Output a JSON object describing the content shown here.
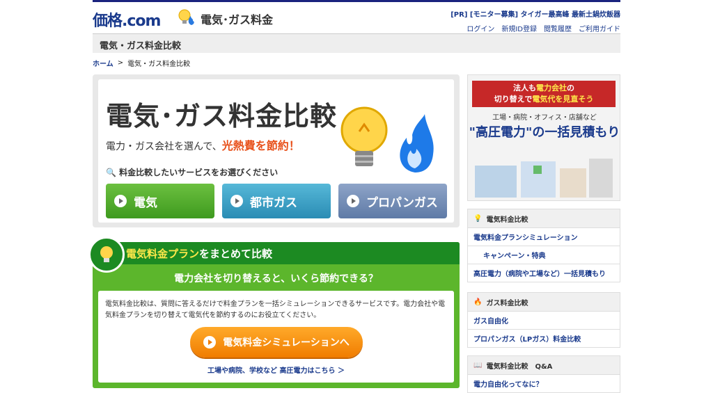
{
  "header": {
    "logo_text": "価格.com",
    "service_name": "電気･ガス料金",
    "pr_text": "[PR] [モニター募集] タイガー最高峰 最新土鍋炊飯器",
    "util_links": [
      "ログイン",
      "新規ID登録",
      "閲覧履歴",
      "ご利用ガイド"
    ]
  },
  "titlebar": {
    "title": "電気・ガス料金比較"
  },
  "breadcrumb": {
    "home": "ホーム",
    "sep": ">",
    "current": "電気・ガス料金比較"
  },
  "hero": {
    "title": "電気･ガス料金比較",
    "sub_pre": "電力・ガス会社を選んで、",
    "sub_em": "光熱費を節約！",
    "question": "料金比較したいサービスをお選びください",
    "services": [
      "電気",
      "都市ガス",
      "プロパンガス"
    ]
  },
  "plan": {
    "title_em": "電気料金プラン",
    "title_rest": "をまとめて比較",
    "question": "電力会社を切り替えると、いくら節約できる？",
    "description": "電気料金比較は、質問に答えるだけで料金プランを一括シミュレーションできるサービスです。電力会社や電気料金プランを切り替えて電気代を節約するのにお役立てください。",
    "button": "電気料金シミュレーションへ",
    "link": "工場や病院、学校など 高圧電力はこちら ＞"
  },
  "ad": {
    "ribbon_line1_a": "法人も",
    "ribbon_line1_b": "電力会社",
    "ribbon_line1_c": "の",
    "ribbon_line2_a": "切り替えで",
    "ribbon_line2_b": "電気代を見直そう",
    "sub": "工場・病院・オフィス・店舗など",
    "main": "\"高圧電力\"の一括見積もり"
  },
  "side_electric": {
    "head": "電気料金比較",
    "items": [
      "電気料金プランシミュレーション",
      "キャンペーン・特典",
      "高圧電力（病院や工場など）一括見積もり"
    ]
  },
  "side_gas": {
    "head": "ガス料金比較",
    "items": [
      "ガス自由化",
      "プロパンガス（LPガス）料金比較"
    ]
  },
  "side_qa": {
    "head": "電気料金比較　Q&A",
    "items": [
      "電力自由化ってなに？"
    ]
  },
  "colors": {
    "brand": "#1a3a8c",
    "green": "#5cb62c",
    "accent": "#e8501a",
    "orange": "#f07c00"
  }
}
